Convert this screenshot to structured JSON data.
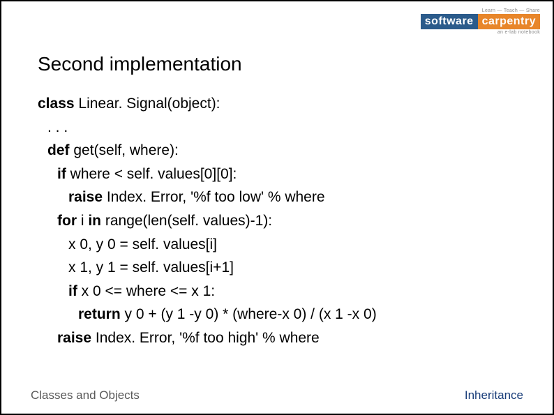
{
  "logo": {
    "tagline_top": "Learn — Teach — Share",
    "software": "software",
    "carpentry": "carpentry",
    "tagline_bottom": "an e-lab notebook"
  },
  "title": "Second implementation",
  "code": {
    "l0_kw": "class",
    "l0_rest": " Linear. Signal(object):",
    "l1": ". . .",
    "l2_kw": "def",
    "l2_rest": " get(self, where):",
    "l3_kw": "if",
    "l3_rest": " where < self. values[0][0]:",
    "l4_kw": "raise",
    "l4_rest": " Index. Error, '%f too low' % where",
    "l5_kw": "for",
    "l5_mid": " i ",
    "l5_kw2": "in",
    "l5_rest": " range(len(self. values)-1):",
    "l6": "x 0, y 0 = self. values[i]",
    "l7": "x 1, y 1 = self. values[i+1]",
    "l8_kw": "if",
    "l8_rest": " x 0 <= where <= x 1:",
    "l9_kw": "return",
    "l9_rest": " y 0 + (y 1 -y 0) * (where-x 0) / (x 1 -x 0)",
    "l10_kw": "raise",
    "l10_rest": " Index. Error, '%f too high' % where"
  },
  "footer": {
    "left": "Classes and Objects",
    "right": "Inheritance"
  }
}
